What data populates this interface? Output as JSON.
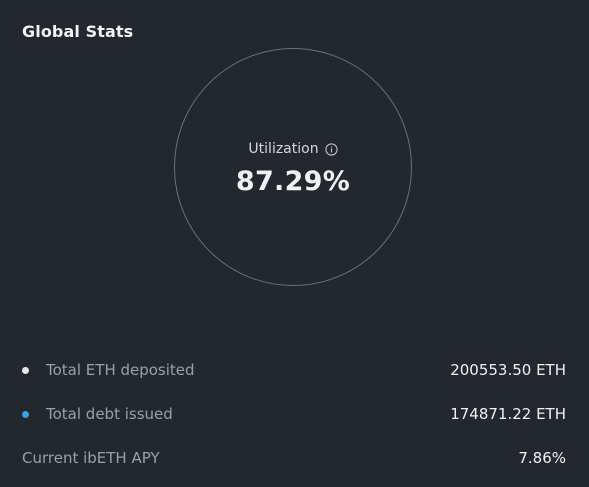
{
  "panel": {
    "title": "Global Stats"
  },
  "utilization": {
    "label": "Utilization",
    "value": "87.29%",
    "info_icon": "info-circle-icon"
  },
  "stats": [
    {
      "label": "Total ETH deposited",
      "value": "200553.50 ETH",
      "dot_color": "#e8eaed",
      "has_dot": true
    },
    {
      "label": "Total debt issued",
      "value": "174871.22 ETH",
      "dot_color": "#3aa0e8",
      "has_dot": true
    },
    {
      "label": "Current ibETH APY",
      "value": "7.86%",
      "has_dot": false
    }
  ],
  "colors": {
    "background": "#23272e",
    "deposit_dot": "#e8eaed",
    "debt_dot": "#3aa0e8"
  }
}
